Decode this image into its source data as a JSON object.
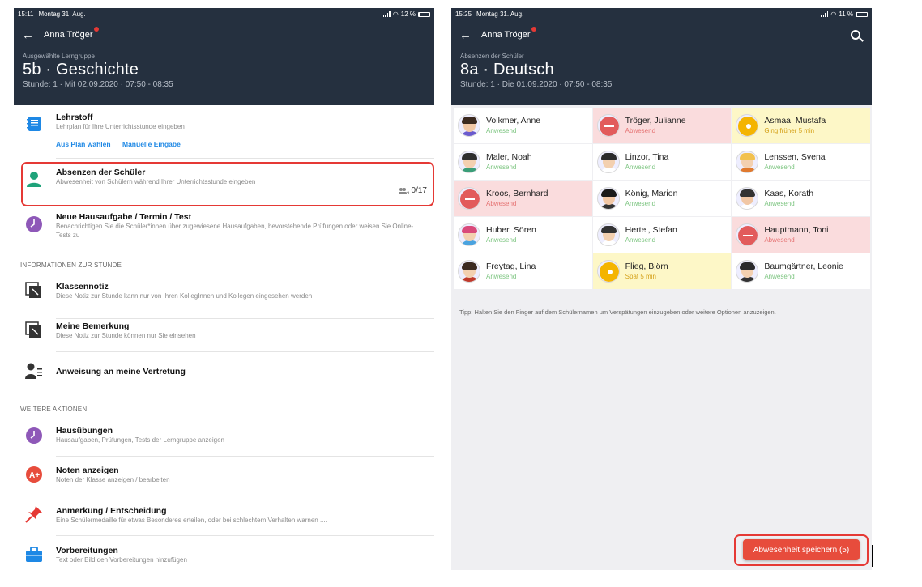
{
  "left": {
    "status": {
      "time": "15:11",
      "date": "Montag 31. Aug.",
      "battery": "12 %",
      "battery_level": 0.12
    },
    "user": "Anna Tröger",
    "group_label": "Ausgewählte Lerngruppe",
    "group_title": "5b · Geschichte",
    "lesson": "Stunde: 1 · Mit 02.09.2020 · 07:50 - 08:35",
    "items": {
      "lehrstoff": {
        "title": "Lehrstoff",
        "desc": "Lehrplan für Ihre Unterrichtsstunde eingeben",
        "link1": "Aus Plan wählen",
        "link2": "Manuelle Eingabe"
      },
      "absenzen": {
        "title": "Absenzen der Schüler",
        "desc": "Abwesenheit von Schülern während Ihrer Unterrichtsstunde eingeben",
        "count": "0/17"
      },
      "hausaufgabe": {
        "title": "Neue Hausaufgabe / Termin / Test",
        "desc": "Benachrichtigen Sie die Schüler*innen über zugewiesene Hausaufgaben, bevorstehende Prüfungen oder weisen Sie Online-Tests zu"
      },
      "section_info": "INFORMATIONEN ZUR STUNDE",
      "klassennotiz": {
        "title": "Klassennotiz",
        "desc": "Diese Notiz zur Stunde kann nur von Ihren KollegInnen und Kollegen eingesehen werden"
      },
      "bemerkung": {
        "title": "Meine Bemerkung",
        "desc": "Diese Notiz zur Stunde können nur Sie einsehen"
      },
      "vertretung": {
        "title": "Anweisung an meine Vertretung"
      },
      "section_actions": "WEITERE AKTIONEN",
      "hausuebungen": {
        "title": "Hausübungen",
        "desc": "Hausaufgaben, Prüfungen, Tests der Lerngruppe anzeigen"
      },
      "noten": {
        "title": "Noten anzeigen",
        "desc": "Noten der Klasse anzeigen / bearbeiten"
      },
      "anmerkung": {
        "title": "Anmerkung / Entscheidung",
        "desc": "Eine Schülermedaille für etwas Besonderes erteilen, oder bei schlechtem Verhalten warnen ...."
      },
      "vorbereitungen": {
        "title": "Vorbereitungen",
        "desc": "Text oder Bild den Vorbereitungen hinzufügen"
      }
    }
  },
  "right": {
    "status": {
      "time": "15:25",
      "date": "Montag 31. Aug.",
      "battery": "11 %",
      "battery_level": 0.11
    },
    "user": "Anna Tröger",
    "group_label": "Absenzen der Schüler",
    "group_title": "8a · Deutsch",
    "lesson": "Stunde: 1 · Die 01.09.2020 · 07:50 - 08:35",
    "students": [
      {
        "name": "Volkmer, Anne",
        "status": "Anwesend",
        "state": "present",
        "hair": "#3c2a1e",
        "skin": "#f1c7a5",
        "shirt": "#6a5acd"
      },
      {
        "name": "Tröger, Julianne",
        "status": "Abwesend",
        "state": "absent",
        "hair": "#7a3b1f",
        "skin": "#f1c7a5",
        "shirt": "#e55"
      },
      {
        "name": "Asmaa, Mustafa",
        "status": "Ging früher 5 min",
        "state": "late",
        "hair": "#222",
        "skin": "#c68b59",
        "shirt": "#f4a300"
      },
      {
        "name": "Maler, Noah",
        "status": "Anwesend",
        "state": "present",
        "hair": "#2e2e2e",
        "skin": "#f3d0b0",
        "shirt": "#3a9e78"
      },
      {
        "name": "Linzor, Tina",
        "status": "Anwesend",
        "state": "present",
        "hair": "#2b2b2b",
        "skin": "#f3d0b0",
        "shirt": "#ffffff"
      },
      {
        "name": "Lenssen, Svena",
        "status": "Anwesend",
        "state": "present",
        "hair": "#f2c14e",
        "skin": "#f3d0b0",
        "shirt": "#e07a2f"
      },
      {
        "name": "Kroos, Bernhard",
        "status": "Abwesend",
        "state": "absent",
        "hair": "#3b2a20",
        "skin": "#f1c7a5",
        "shirt": "#d33"
      },
      {
        "name": "König, Marion",
        "status": "Anwesend",
        "state": "present",
        "hair": "#1a1a1a",
        "skin": "#f1c7a5",
        "shirt": "#333"
      },
      {
        "name": "Kaas, Korath",
        "status": "Anwesend",
        "state": "present",
        "hair": "#333",
        "skin": "#f1c7a5",
        "shirt": "#ffffff"
      },
      {
        "name": "Huber, Sören",
        "status": "Anwesend",
        "state": "present",
        "hair": "#d94a7a",
        "skin": "#f3d0b0",
        "shirt": "#4aa3df"
      },
      {
        "name": "Hertel, Stefan",
        "status": "Anwesend",
        "state": "present",
        "hair": "#333",
        "skin": "#f3d0b0",
        "shirt": "#ffffff"
      },
      {
        "name": "Hauptmann, Toni",
        "status": "Abwesend",
        "state": "absent",
        "hair": "#3b2a20",
        "skin": "#f1c7a5",
        "shirt": "#d33"
      },
      {
        "name": "Freytag, Lina",
        "status": "Anwesend",
        "state": "present",
        "hair": "#3b2a20",
        "skin": "#f3d0b0",
        "shirt": "#c0392b"
      },
      {
        "name": "Flieg, Björn",
        "status": "Spät 5 min",
        "state": "late",
        "hair": "#6b4a2a",
        "skin": "#f1c7a5",
        "shirt": "#f4a300"
      },
      {
        "name": "Baumgärtner, Leonie",
        "status": "Anwesend",
        "state": "present",
        "hair": "#2b2b2b",
        "skin": "#f3d0b0",
        "shirt": "#333"
      }
    ],
    "tip": "Tipp: Halten Sie den Finger auf dem Schülernamen um Verspätungen einzugeben oder weitere Optionen anzuzeigen.",
    "save_button": "Abwesenheit speichern (5)"
  },
  "colors": {
    "header": "#25303f",
    "accent": "#1e88e5",
    "absent_bg": "#fadcdd",
    "late_bg": "#fdf7c7",
    "highlight": "#e53935",
    "present_text": "#7bc47f",
    "absent_text": "#e57373",
    "late_text": "#d4a017"
  },
  "icons": {
    "back": "arrow-left-icon",
    "search": "search-icon",
    "notify": "notification-dot-icon"
  }
}
